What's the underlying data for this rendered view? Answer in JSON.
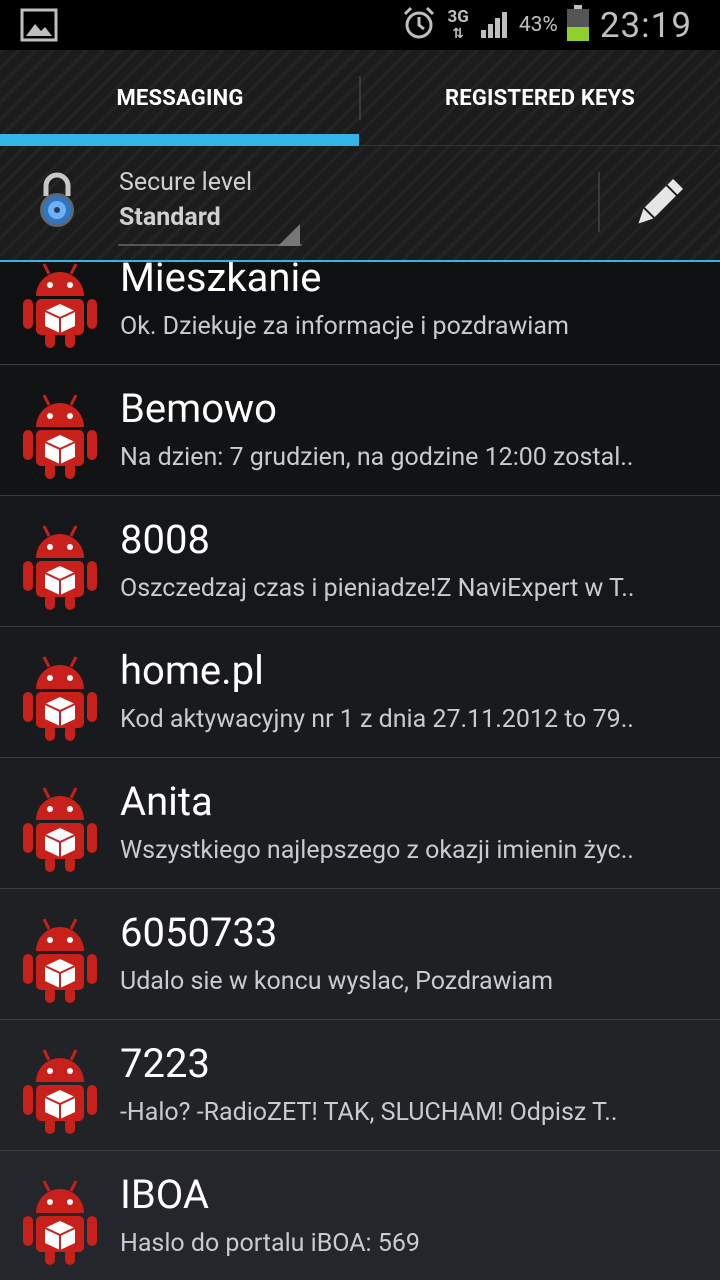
{
  "status_bar": {
    "network": "3G",
    "battery_percent": "43%",
    "battery_level": 0.43,
    "time": "23:19",
    "icons": [
      "image-notification-icon",
      "alarm-icon",
      "signal-icon",
      "battery-icon"
    ]
  },
  "tabs": [
    {
      "label": "MESSAGING",
      "selected": true
    },
    {
      "label": "REGISTERED KEYS",
      "selected": false
    }
  ],
  "secure": {
    "label": "Secure level",
    "value": "Standard"
  },
  "colors": {
    "accent": "#33b5e5",
    "android_red": "#c8201a",
    "battery_green": "#8fd12b"
  },
  "conversations": [
    {
      "name": "Mieszkanie",
      "snippet": "Ok. Dziekuje za informacje i pozdrawiam"
    },
    {
      "name": "Bemowo",
      "snippet": "Na dzien: 7 grudzien, na godzine 12:00 zostal.."
    },
    {
      "name": "8008",
      "snippet": "Oszczedzaj czas i pieniadze!Z NaviExpert w T.."
    },
    {
      "name": "home.pl",
      "snippet": "Kod aktywacyjny nr 1 z dnia 27.11.2012 to 79.."
    },
    {
      "name": "Anita",
      "snippet": "Wszystkiego najlepszego z okazji imienin życ.."
    },
    {
      "name": "6050733",
      "snippet": "Udalo sie w koncu wyslac, Pozdrawiam"
    },
    {
      "name": "7223",
      "snippet": "-Halo? -RadioZET! TAK, SLUCHAM!  Odpisz T.."
    },
    {
      "name": "IBOA",
      "snippet": "Haslo do portalu iBOA: 569"
    }
  ]
}
